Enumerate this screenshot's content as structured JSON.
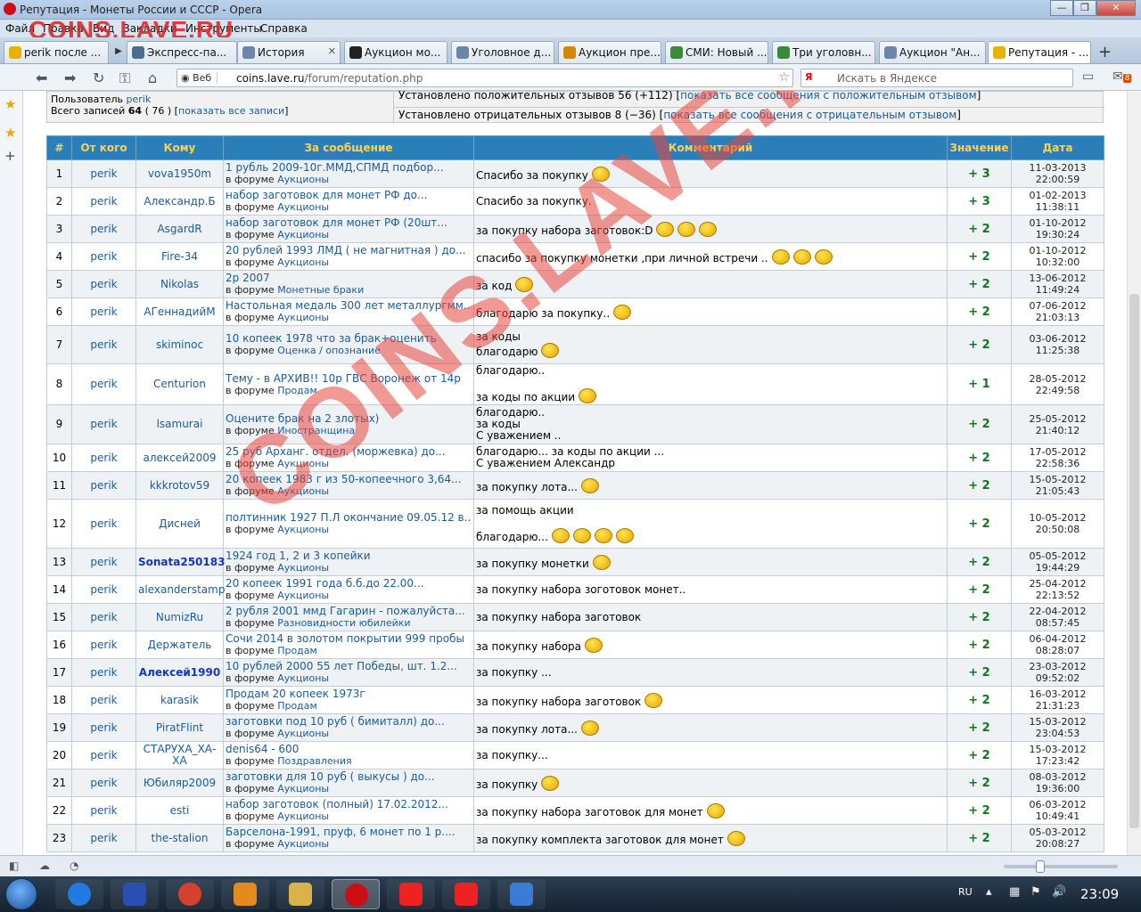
{
  "window": {
    "title": "Репутация - Монеты России и СССР - Opera",
    "btn_min": "—",
    "btn_max": "❐",
    "btn_close": "✕"
  },
  "brand": "COINS.LAVE.RU",
  "menu": [
    "Файл",
    "Правка",
    "Вид",
    "Закладки",
    "Инструменты",
    "Справка"
  ],
  "tabs": [
    {
      "label": "perik после ...",
      "color": "#e8b300"
    },
    {
      "label": "Экспресс-па...",
      "color": "#4b6d92"
    },
    {
      "label": "История",
      "color": "#6a87a8"
    },
    {
      "label": "Аукцион мо...",
      "color": "#222"
    },
    {
      "label": "Уголовное д...",
      "color": "#6a87a8"
    },
    {
      "label": "Аукцион пре...",
      "color": "#d48800"
    },
    {
      "label": "СМИ: Новый ...",
      "color": "#3b8a3b"
    },
    {
      "label": "Три уголовн...",
      "color": "#3b8a3b"
    },
    {
      "label": "Аукцион \"Ан...",
      "color": "#6a87a8"
    },
    {
      "label": "Репутация - ...",
      "color": "#e8b300"
    }
  ],
  "tab_close": "✕",
  "address": {
    "web_label": "Веб",
    "url_host": "coins.lave.ru",
    "url_path": "/forum/reputation.php",
    "search_placeholder": "Искать в Яндексе",
    "search_logo": "Я"
  },
  "info": {
    "user_label": "Пользователь",
    "user": "perik",
    "total_label": "Всего записей",
    "total": "64",
    "total_paren": "( 76 )",
    "show_all": "показать все записи",
    "pos_text": "Установлено положительных отзывов 56 (+112)",
    "pos_link": "показать все сообщения с положительным отзывом",
    "neg_text": "Установлено отрицательных отзывов 8 (−36)",
    "neg_link": "показать все сообщения с отрицательным отзывом"
  },
  "table": {
    "headers": [
      "#",
      "От кого",
      "Кому",
      "За сообщение",
      "Комментарий",
      "Значение",
      "Дата"
    ],
    "forum_prefix": "в форуме",
    "rows": [
      {
        "n": "1",
        "from": "perik",
        "to": "vova1950m",
        "msg": "1 рубль 2009-10г.ММД,СПМД подбор...",
        "forum": "Аукционы",
        "comment": "Спасибо за покупку",
        "smiles": 1,
        "val": "+ 3",
        "date": "11-03-2013",
        "time": "22:00:59",
        "h": 31
      },
      {
        "n": "2",
        "from": "perik",
        "to": "Александр.Б",
        "msg": "набор заготовок для монет РФ до...",
        "forum": "Аукционы",
        "comment": "Спасибо за покупку.",
        "smiles": 0,
        "val": "+ 3",
        "date": "01-02-2013",
        "time": "11:38:11",
        "h": 31
      },
      {
        "n": "3",
        "from": "perik",
        "to": "AsgardR",
        "msg": "набор заготовок для монет РФ (20шт...",
        "forum": "Аукционы",
        "comment": "за покупку набора заготовок:D",
        "smiles": 3,
        "val": "+ 2",
        "date": "01-10-2012",
        "time": "19:30:24",
        "h": 31
      },
      {
        "n": "4",
        "from": "perik",
        "to": "Fire-34",
        "msg": "20 рублей 1993 ЛМД ( не магнитная ) до...",
        "forum": "Аукционы",
        "comment": "спасибо за покупку монетки ,при личной встречи ..",
        "smiles": 3,
        "val": "+ 2",
        "date": "01-10-2012",
        "time": "10:32:00",
        "h": 31
      },
      {
        "n": "5",
        "from": "perik",
        "to": "Nikolas",
        "msg": "2р 2007",
        "forum": "Монетные браки",
        "comment": "за код",
        "smiles": 1,
        "val": "+ 2",
        "date": "13-06-2012",
        "time": "11:49:24",
        "h": 31
      },
      {
        "n": "6",
        "from": "perik",
        "to": "АГеннадийМ",
        "msg": "Настольная медаль 300 лет металлургмм...",
        "forum": "Аукционы",
        "comment": "благодарю за покупку..",
        "smiles": 1,
        "val": "+ 2",
        "date": "07-06-2012",
        "time": "21:03:13",
        "h": 31
      },
      {
        "n": "7",
        "from": "perik",
        "to": "skiminoc",
        "msg": "10 копеек 1978 что за брак+оценить",
        "forum": "Оценка / опознание",
        "comment": "за коды\nблагодарю",
        "smiles": 1,
        "val": "+ 2",
        "date": "03-06-2012",
        "time": "11:25:38",
        "h": 43
      },
      {
        "n": "8",
        "from": "perik",
        "to": "Centurion",
        "msg": "Тему - в АРХИВ!! 10р ГВС Воронеж от 14р",
        "forum": "Продам",
        "comment": "благодарю..\n\nза коды по акции",
        "smiles": 1,
        "val": "+ 1",
        "date": "28-05-2012",
        "time": "22:49:58",
        "h": 43
      },
      {
        "n": "9",
        "from": "perik",
        "to": "lsamurai",
        "msg": "Оцените брак на 2 злотых)",
        "forum": "Иностранщина",
        "comment": "благодарю..\nза коды\nС уважением ..",
        "smiles": 0,
        "val": "+ 2",
        "date": "25-05-2012",
        "time": "21:40:12",
        "h": 44
      },
      {
        "n": "10",
        "from": "perik",
        "to": "алексей2009",
        "msg": "25 руб Арханг. отдел. (моржевка) до...",
        "forum": "Аукционы",
        "comment": "благодарю... за коды по акции ...\nС уважением Александр",
        "smiles": 0,
        "val": "+ 2",
        "date": "17-05-2012",
        "time": "22:58:36",
        "h": 31
      },
      {
        "n": "11",
        "from": "perik",
        "to": "kkkrotov59",
        "msg": "20 копеек 1983 г из 50-копеечного 3,64...",
        "forum": "Аукционы",
        "comment": "за покупку лота...",
        "smiles": 1,
        "val": "+ 2",
        "date": "15-05-2012",
        "time": "21:05:43",
        "h": 31
      },
      {
        "n": "12",
        "from": "perik",
        "to": "Дисней",
        "msg": "полтинник 1927 П.Л окончание 09.05.12 в...",
        "forum": "Аукционы",
        "comment": "за помощь акции\n\nблагодарю...",
        "smiles": 4,
        "val": "+ 2",
        "date": "10-05-2012",
        "time": "20:50:08",
        "h": 55
      },
      {
        "n": "13",
        "from": "perik",
        "to": "Sonata250183",
        "msg": "1924 год 1, 2 и 3 копейки",
        "forum": "Аукционы",
        "comment": "за покупку монетки",
        "smiles": 1,
        "val": "+ 2",
        "date": "05-05-2012",
        "time": "19:44:29",
        "h": 31,
        "bold": true
      },
      {
        "n": "14",
        "from": "perik",
        "to": "alexanderstamp",
        "msg": "20 копеек 1991 года б.б.до 22.00...",
        "forum": "Аукционы",
        "comment": "за покупку набора зоготовок монет..",
        "smiles": 0,
        "val": "+ 2",
        "date": "25-04-2012",
        "time": "22:13:52",
        "h": 31
      },
      {
        "n": "15",
        "from": "perik",
        "to": "NumizRu",
        "msg": "2 рубля 2001 ммд Гагарин - пожалуйста...",
        "forum": "Разновидности юбилейки",
        "comment": "за покупку набора заготовок",
        "smiles": 0,
        "val": "+ 2",
        "date": "22-04-2012",
        "time": "08:57:45",
        "h": 31
      },
      {
        "n": "16",
        "from": "perik",
        "to": "Держатель",
        "msg": "Сочи 2014 в золотом покрытии 999 пробы",
        "forum": "Продам",
        "comment": "за покупку набора",
        "smiles": 1,
        "val": "+ 2",
        "date": "06-04-2012",
        "time": "08:28:07",
        "h": 31
      },
      {
        "n": "17",
        "from": "perik",
        "to": "Алексей1990",
        "msg": "10 рублей 2000 55 лет Победы, шт. 1.2...",
        "forum": "Аукционы",
        "comment": "за покупку ...",
        "smiles": 0,
        "val": "+ 2",
        "date": "23-03-2012",
        "time": "09:52:02",
        "h": 31,
        "bold": true
      },
      {
        "n": "18",
        "from": "perik",
        "to": "karasik",
        "msg": "Продам 20 копеек 1973г",
        "forum": "Продам",
        "comment": "за покупку набора заготовок",
        "smiles": 1,
        "val": "+ 2",
        "date": "16-03-2012",
        "time": "21:31:23",
        "h": 31
      },
      {
        "n": "19",
        "from": "perik",
        "to": "PiratFlint",
        "msg": "заготовки под 10 руб ( бимиталл) до...",
        "forum": "Аукционы",
        "comment": "за покупку лота...",
        "smiles": 1,
        "val": "+ 2",
        "date": "15-03-2012",
        "time": "23:04:53",
        "h": 31
      },
      {
        "n": "20",
        "from": "perik",
        "to": "СТАРУХА_ХА-ХА",
        "msg": "denis64 - 600",
        "forum": "Поздравления",
        "comment": "за покупку...",
        "smiles": 0,
        "val": "+ 2",
        "date": "15-03-2012",
        "time": "17:23:42",
        "h": 31
      },
      {
        "n": "21",
        "from": "perik",
        "to": "Юбиляр2009",
        "msg": "заготовки для 10 руб ( выкусы ) до...",
        "forum": "Аукционы",
        "comment": "за покупку",
        "smiles": 1,
        "val": "+ 2",
        "date": "08-03-2012",
        "time": "19:36:00",
        "h": 31
      },
      {
        "n": "22",
        "from": "perik",
        "to": "esti",
        "msg": "набор заготовок (полный) 17.02.2012...",
        "forum": "Аукционы",
        "comment": "за покупку набора заготовок для монет",
        "smiles": 1,
        "val": "+ 2",
        "date": "06-03-2012",
        "time": "10:49:41",
        "h": 31
      },
      {
        "n": "23",
        "from": "perik",
        "to": "the-stalion",
        "msg": "Барселона-1991, пруф, 6 монет по 1 р....",
        "forum": "Аукционы",
        "comment": "за покупку комплекта заготовок для монет",
        "smiles": 1,
        "val": "+ 2",
        "date": "05-03-2012",
        "time": "20:08:27",
        "h": 31
      }
    ]
  },
  "taskbar": {
    "lang": "RU",
    "time": "23:09",
    "apps": [
      {
        "name": "ie",
        "color": "#1f7be0"
      },
      {
        "name": "save",
        "color": "#2a4fb0"
      },
      {
        "name": "chrome",
        "color": "#d6402f"
      },
      {
        "name": "media",
        "color": "#e58a1f"
      },
      {
        "name": "explorer",
        "color": "#d9b24c"
      },
      {
        "name": "opera",
        "color": "#cc0f16",
        "active": true
      },
      {
        "name": "yandex-search",
        "color": "#e22"
      },
      {
        "name": "yandex-browser",
        "color": "#e22"
      },
      {
        "name": "audio",
        "color": "#3a7bd5"
      }
    ]
  },
  "badge": "8"
}
